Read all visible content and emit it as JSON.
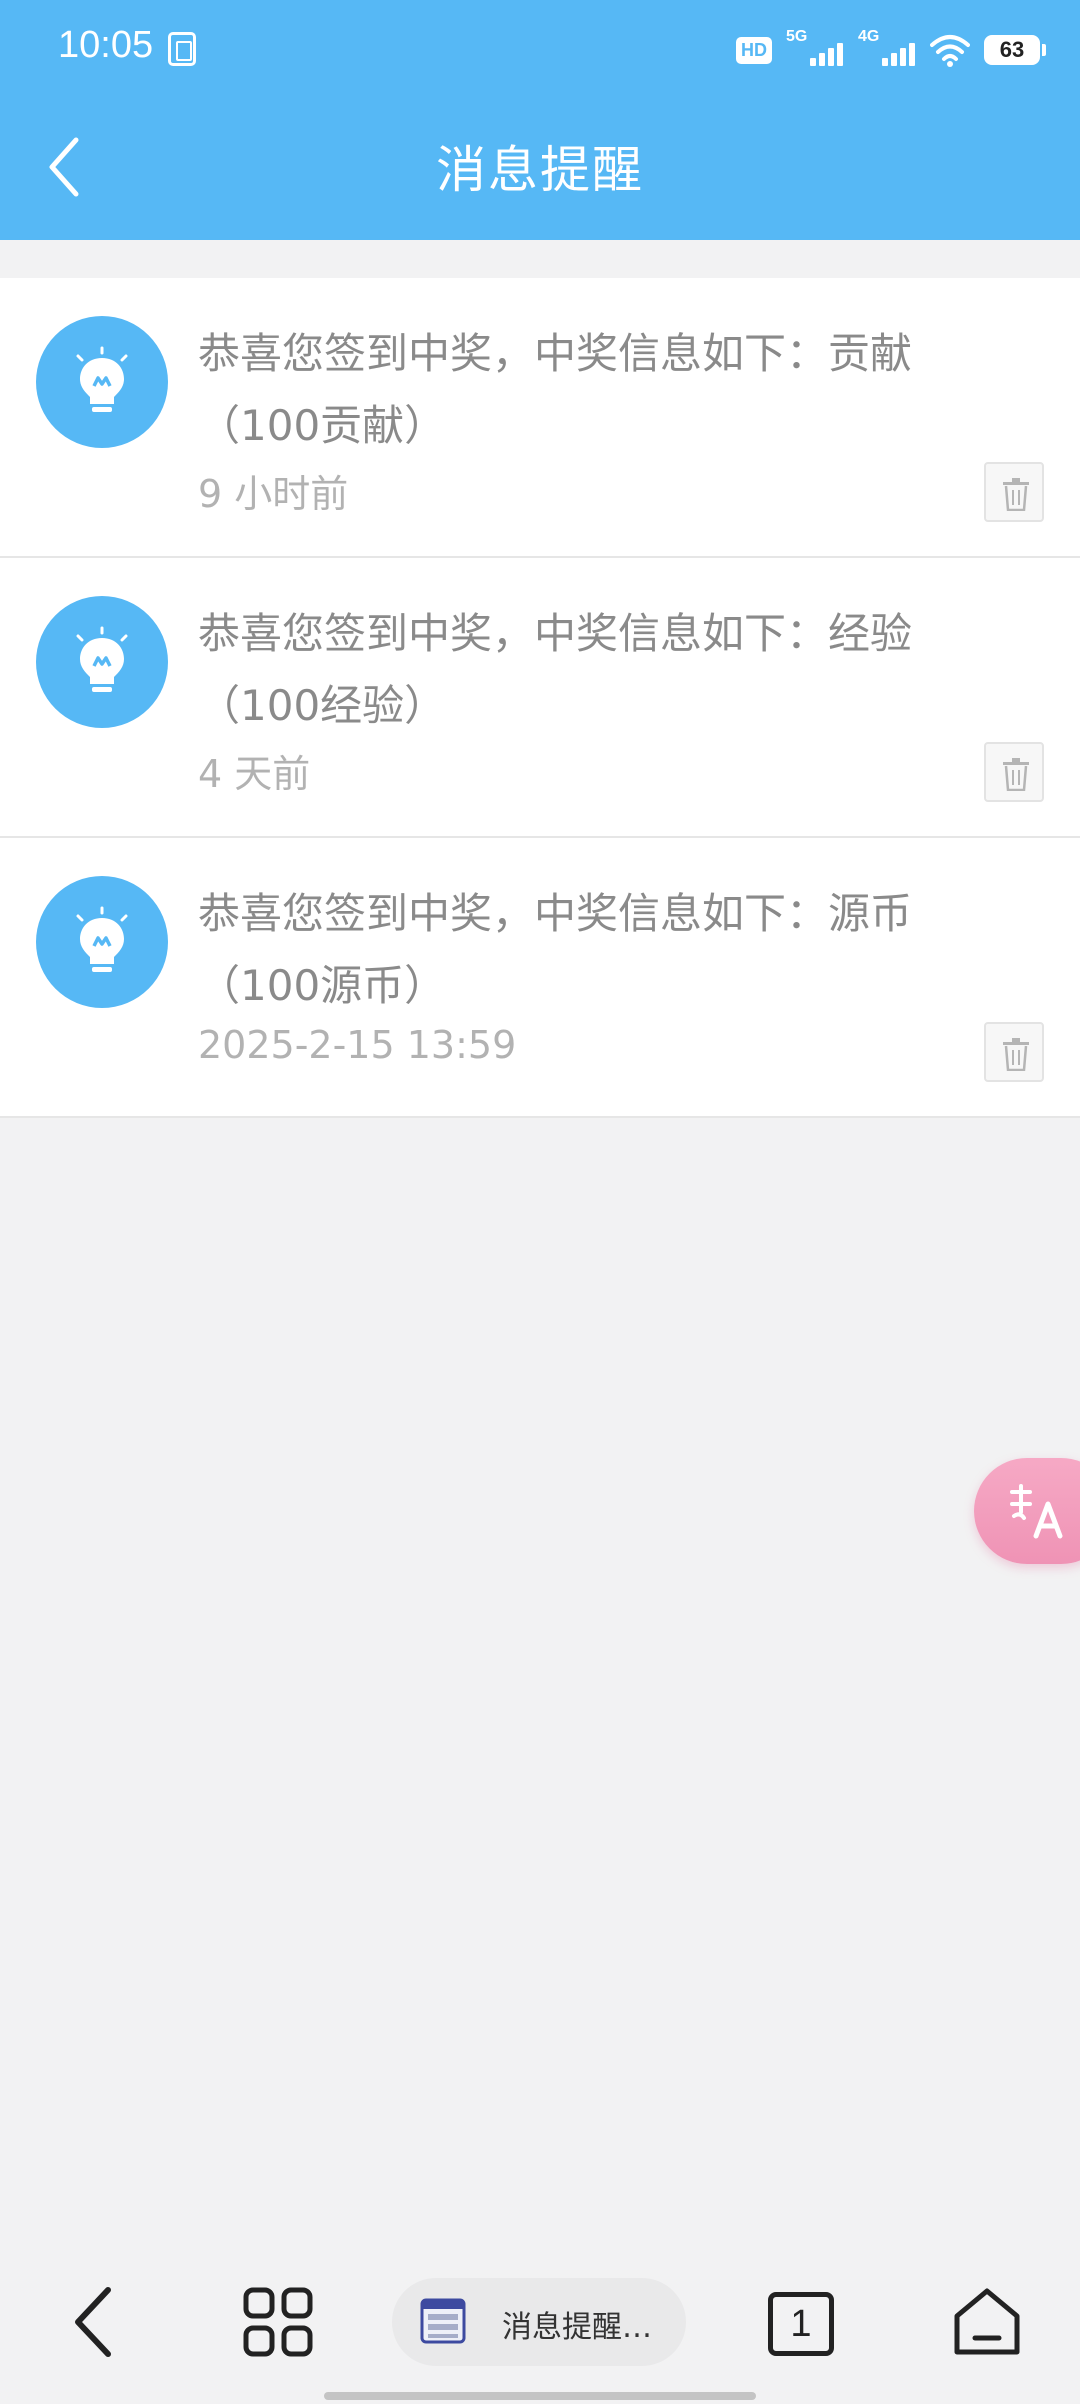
{
  "status_bar": {
    "time": "10:05",
    "hd_label": "HD",
    "net1_label": "5G",
    "net2_label": "4G",
    "battery": "63"
  },
  "header": {
    "title": "消息提醒",
    "color": "#56b8f5"
  },
  "messages": [
    {
      "text": "恭喜您签到中奖，中奖信息如下：贡献（100贡献）",
      "time": "9 小时前"
    },
    {
      "text": "恭喜您签到中奖，中奖信息如下：经验（100经验）",
      "time": "4 天前"
    },
    {
      "text": "恭喜您签到中奖，中奖信息如下：源币（100源币）",
      "time": "2025-2-15 13:59"
    }
  ],
  "nav": {
    "tab_label": "消息提醒…",
    "tab_count": "1"
  },
  "icons": {
    "avatar": "lightbulb-icon",
    "delete": "trash-icon",
    "fab": "translate-icon"
  }
}
